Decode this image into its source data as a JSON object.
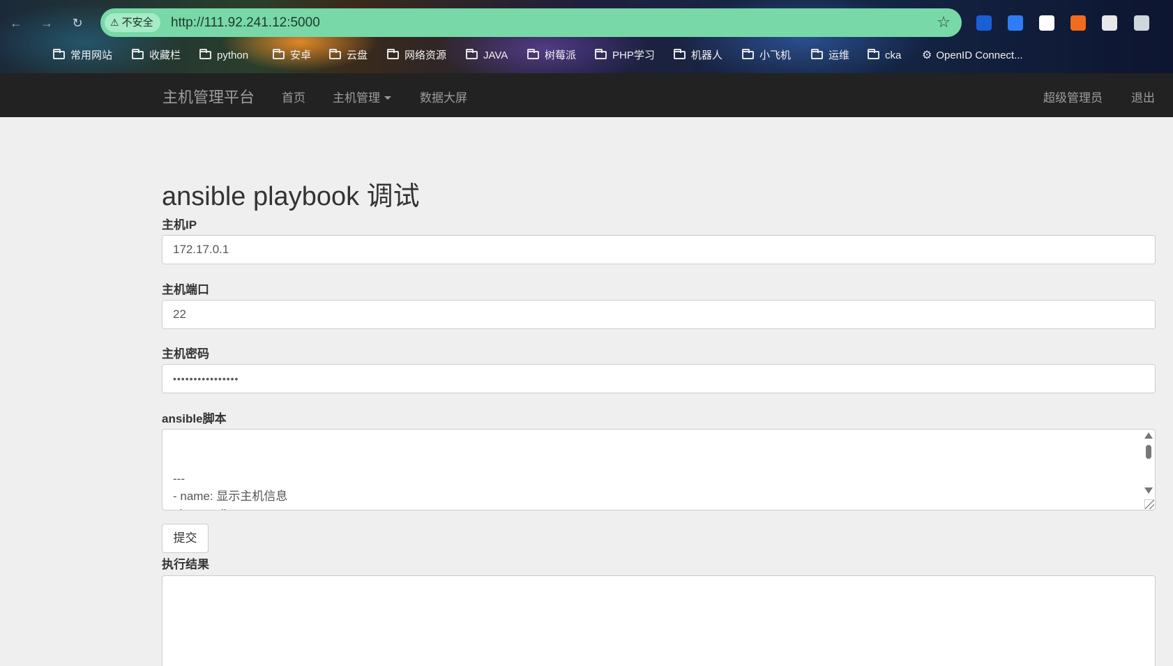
{
  "browser": {
    "security_label": "不安全",
    "url": "http://111.92.241.12:5000",
    "bookmarks": [
      {
        "label": "常用网站",
        "icon": "folder-icon"
      },
      {
        "label": "收藏栏",
        "icon": "folder-icon"
      },
      {
        "label": "python",
        "icon": "folder-icon"
      },
      {
        "label": "安卓",
        "icon": "folder-icon"
      },
      {
        "label": "云盘",
        "icon": "folder-icon"
      },
      {
        "label": "网络资源",
        "icon": "folder-icon"
      },
      {
        "label": "JAVA",
        "icon": "folder-icon"
      },
      {
        "label": "树莓派",
        "icon": "folder-icon"
      },
      {
        "label": "PHP学习",
        "icon": "folder-icon"
      },
      {
        "label": "机器人",
        "icon": "folder-icon"
      },
      {
        "label": "小飞机",
        "icon": "folder-icon"
      },
      {
        "label": "运维",
        "icon": "folder-icon"
      },
      {
        "label": "cka",
        "icon": "folder-icon"
      },
      {
        "label": "OpenID Connect...",
        "icon": "gear-icon"
      }
    ],
    "extensions": [
      {
        "name": "check-extension-icon",
        "color": "#1a5fd6"
      },
      {
        "name": "translate-extension-icon",
        "color": "#2f7df6"
      },
      {
        "name": "qr-extension-icon",
        "color": "#ffffff"
      },
      {
        "name": "code-extension-icon",
        "color": "#f26b1d"
      },
      {
        "name": "reader-extension-icon",
        "color": "#e8e8e8"
      },
      {
        "name": "puzzle-extension-icon",
        "color": "#cfd6dd"
      }
    ]
  },
  "navbar": {
    "brand": "主机管理平台",
    "items": [
      "首页",
      "主机管理",
      "数据大屏"
    ],
    "user": "超级管理员",
    "logout": "退出"
  },
  "form": {
    "title": "ansible playbook 调试",
    "host_ip_label": "主机IP",
    "host_ip_value": "172.17.0.1",
    "host_port_label": "主机端口",
    "host_port_value": "22",
    "host_password_label": "主机密码",
    "host_password_value": "••••••••••••••••",
    "script_label": "ansible脚本",
    "script_value": "---\n- name: 显示主机信息\n  hosts: all\n  gather_facts: yes\n  tasks:",
    "submit_label": "提交",
    "result_label": "执行结果"
  },
  "colors": {
    "navbar_bg": "#222222",
    "navbar_text": "#9d9d9d",
    "page_bg": "#efefef",
    "omnibox": "#78d8a8"
  }
}
